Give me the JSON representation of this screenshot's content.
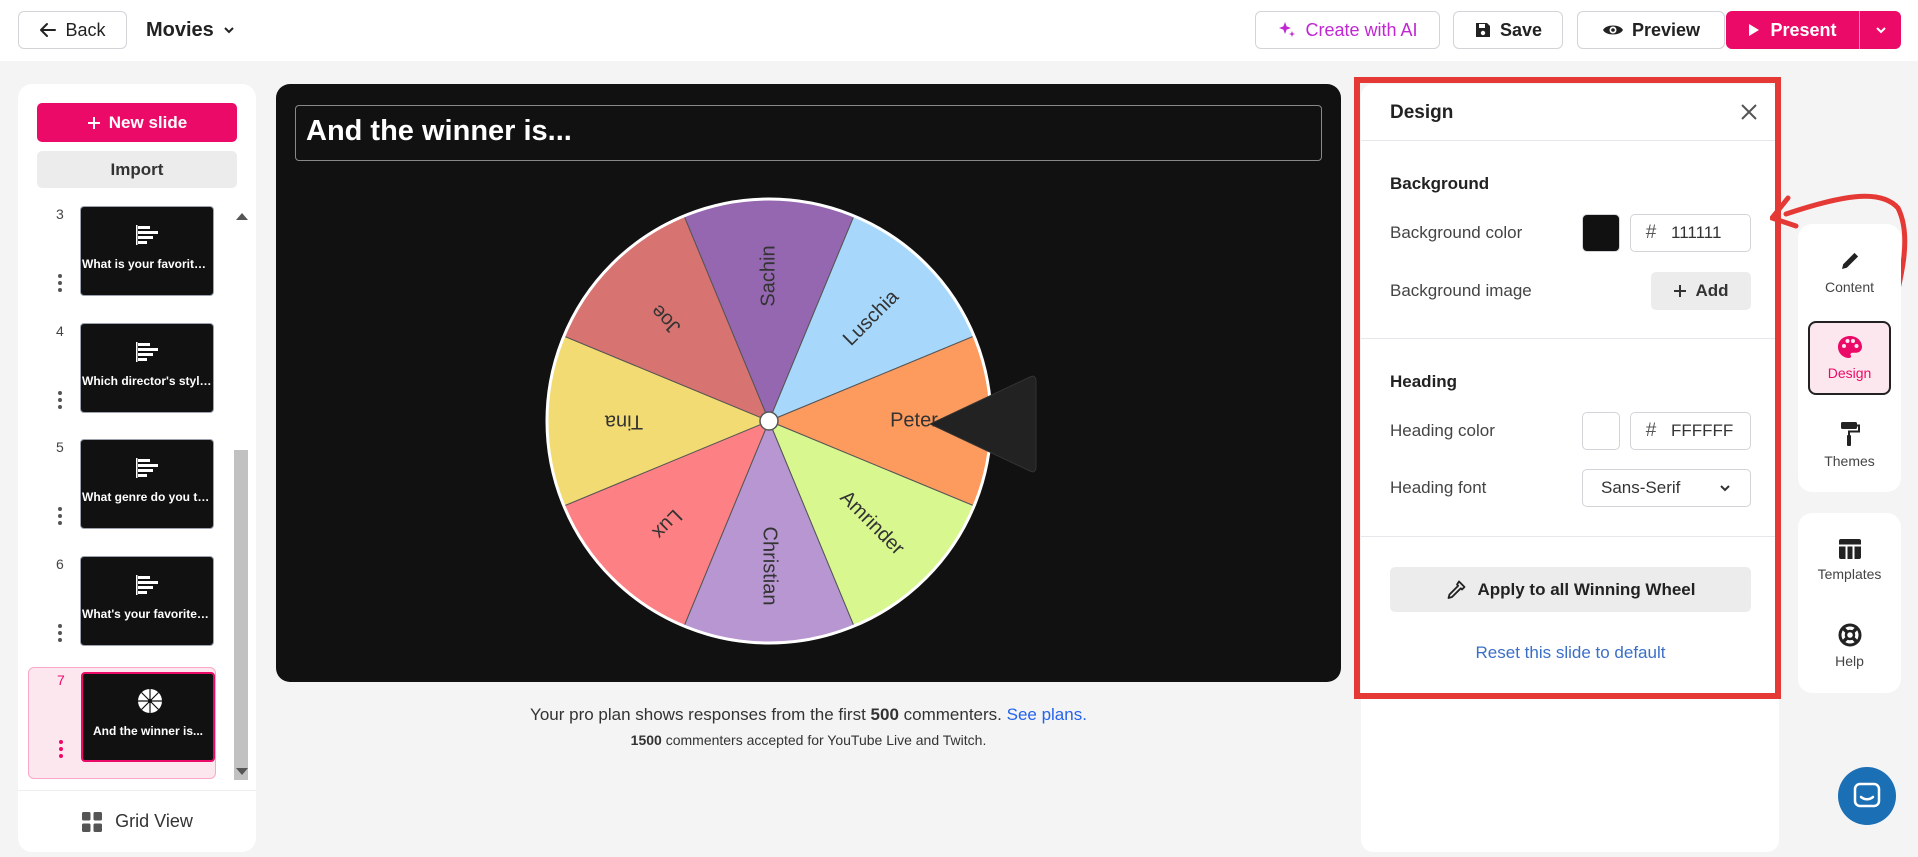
{
  "topbar": {
    "back_label": "Back",
    "title": "Movies",
    "ai_label": "Create with AI",
    "save_label": "Save",
    "preview_label": "Preview",
    "present_label": "Present"
  },
  "sidebar": {
    "new_slide_label": "New slide",
    "import_label": "Import",
    "grid_view_label": "Grid View",
    "slides": [
      {
        "num": "3",
        "text": "What is your favorite mo..."
      },
      {
        "num": "4",
        "text": "Which director's style do..."
      },
      {
        "num": "5",
        "text": "What genre do you think..."
      },
      {
        "num": "6",
        "text": "What's your favorite mov..."
      },
      {
        "num": "7",
        "text": "And the winner is..."
      }
    ]
  },
  "canvas": {
    "heading": "And the winner is...",
    "background": "#111111",
    "wheel_segments": [
      {
        "name": "Sachin",
        "color": "#9467b0"
      },
      {
        "name": "Luschia",
        "color": "#a7d8fb"
      },
      {
        "name": "Peter",
        "color": "#fd9b5e"
      },
      {
        "name": "Amrinder",
        "color": "#d9f78f"
      },
      {
        "name": "Christian",
        "color": "#b796d1"
      },
      {
        "name": "Lux",
        "color": "#fd8184"
      },
      {
        "name": "Tina",
        "color": "#f2db72"
      },
      {
        "name": "Joe",
        "color": "#d77371"
      }
    ]
  },
  "plan_note": {
    "prefix": "Your pro plan shows responses from the first ",
    "count": "500",
    "suffix": " commenters. ",
    "link": "See plans.",
    "count2": "1500",
    "suffix2": " commenters accepted for YouTube Live and Twitch."
  },
  "design": {
    "title": "Design",
    "background_title": "Background",
    "bg_color_label": "Background color",
    "bg_color_value": "111111",
    "bg_image_label": "Background image",
    "add_label": "Add",
    "heading_title": "Heading",
    "heading_color_label": "Heading color",
    "heading_color_value": "FFFFFF",
    "heading_font_label": "Heading font",
    "heading_font_value": "Sans-Serif",
    "apply_label": "Apply to all Winning Wheel",
    "reset_label": "Reset this slide to default"
  },
  "rail": {
    "content": "Content",
    "design": "Design",
    "themes": "Themes",
    "templates": "Templates",
    "help": "Help"
  },
  "colors": {
    "accent": "#ec0a68",
    "annotation": "#e53935"
  }
}
